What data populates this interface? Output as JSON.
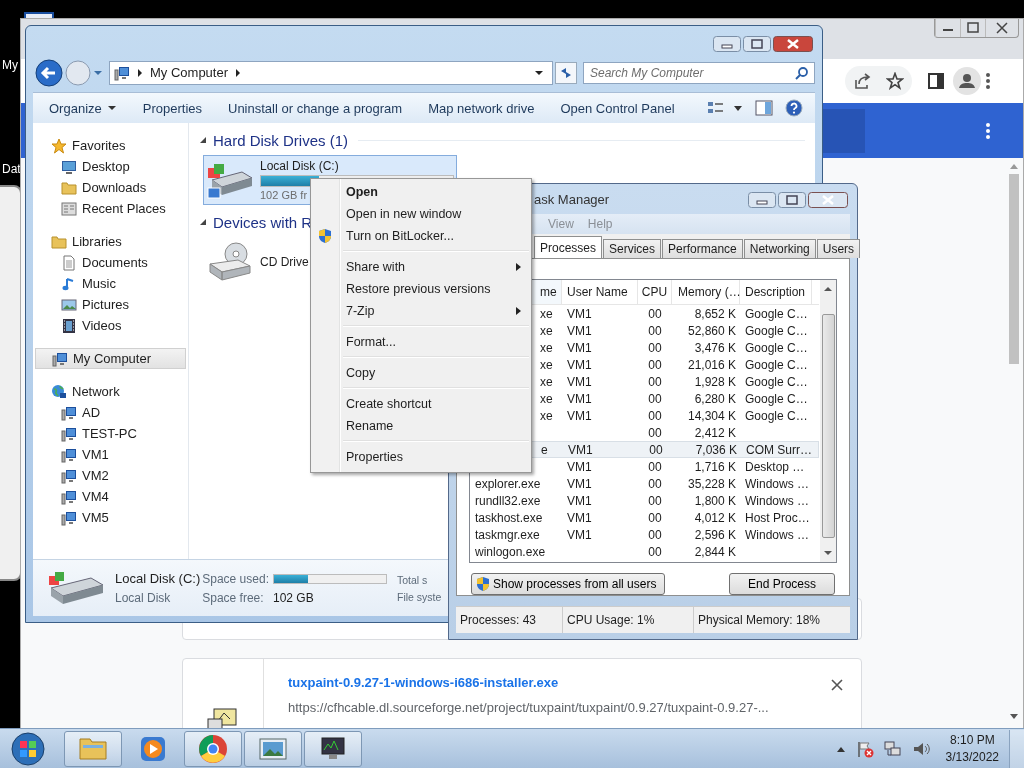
{
  "desktop": {
    "icons": [
      {
        "label": "My"
      },
      {
        "label": "Dat"
      }
    ]
  },
  "browser": {
    "downloads": [
      {
        "filename": "tuxpaint-0.9.27-1-windows-i686-installer.exe",
        "url": "https://cfhcable.dl.sourceforge.net/project/tuxpaint/tuxpaint/0.9.27/tuxpaint-0.9.27-..."
      }
    ]
  },
  "explorer": {
    "address": {
      "crumbs": [
        "My Computer"
      ]
    },
    "search": {
      "placeholder": "Search My Computer"
    },
    "toolbar": [
      {
        "label": "Organize",
        "dropdown": true
      },
      {
        "label": "Properties",
        "dropdown": false
      },
      {
        "label": "Uninstall or change a program",
        "dropdown": false
      },
      {
        "label": "Map network drive",
        "dropdown": false
      },
      {
        "label": "Open Control Panel",
        "dropdown": false
      }
    ],
    "nav": [
      {
        "label": "Favorites",
        "kind": "star",
        "selected": false,
        "children": [
          {
            "label": "Desktop",
            "kind": "monitor",
            "selected": false
          },
          {
            "label": "Downloads",
            "kind": "folder",
            "selected": false
          },
          {
            "label": "Recent Places",
            "kind": "grid",
            "selected": false
          }
        ]
      },
      {
        "label": "Libraries",
        "kind": "folder",
        "selected": false,
        "children": [
          {
            "label": "Documents",
            "kind": "document",
            "selected": false
          },
          {
            "label": "Music",
            "kind": "note",
            "selected": false
          },
          {
            "label": "Pictures",
            "kind": "picture",
            "selected": false
          },
          {
            "label": "Videos",
            "kind": "film",
            "selected": false
          }
        ]
      },
      {
        "label": "My Computer",
        "kind": "computer",
        "selected": true
      },
      {
        "label": "Network",
        "kind": "globe",
        "selected": false,
        "children": [
          {
            "label": "AD",
            "kind": "computer",
            "selected": false
          },
          {
            "label": "TEST-PC",
            "kind": "computer",
            "selected": false
          },
          {
            "label": "VM1",
            "kind": "computer",
            "selected": false
          },
          {
            "label": "VM2",
            "kind": "computer",
            "selected": false
          },
          {
            "label": "VM4",
            "kind": "computer",
            "selected": false
          },
          {
            "label": "VM5",
            "kind": "computer",
            "selected": false
          }
        ]
      }
    ],
    "groups": [
      {
        "title": "Hard Disk Drives (1)",
        "expanded": true,
        "items": [
          {
            "name": "Local Disk (C:)",
            "kind": "disk",
            "detail": "102 GB fr",
            "level": 0.3,
            "selected": true
          }
        ]
      },
      {
        "title": "Devices with R",
        "expanded": true,
        "items": [
          {
            "name": "CD Drive",
            "kind": "cd",
            "selected": false
          }
        ]
      }
    ],
    "details": {
      "name": "Local Disk (C:)",
      "type": "Local Disk",
      "used_label": "Space used:",
      "level": 0.3,
      "free_label": "Space free:",
      "free": "102 GB",
      "total_label": "Total s",
      "fs_label": "File syste"
    }
  },
  "task_manager": {
    "title": "ask Manager",
    "menu": [
      "View",
      "Help"
    ],
    "tabs": [
      {
        "label": "Processes",
        "selected": true
      },
      {
        "label": "Services",
        "selected": false
      },
      {
        "label": "Performance",
        "selected": false
      },
      {
        "label": "Networking",
        "selected": false
      },
      {
        "label": "Users",
        "selected": false
      }
    ],
    "columns": [
      {
        "label": "me",
        "cut": true
      },
      {
        "label": "User Name",
        "cut": false
      },
      {
        "label": "CPU",
        "cut": false
      },
      {
        "label": "Memory (…",
        "cut": false
      },
      {
        "label": "Description",
        "cut": false
      }
    ],
    "rows": [
      {
        "name": "xe",
        "cut": true,
        "user": "VM1",
        "cpu": "00",
        "memory": "8,652 K",
        "description": "Google C…",
        "selected": false
      },
      {
        "name": "xe",
        "cut": true,
        "user": "VM1",
        "cpu": "00",
        "memory": "52,860 K",
        "description": "Google C…",
        "selected": false
      },
      {
        "name": "xe",
        "cut": true,
        "user": "VM1",
        "cpu": "00",
        "memory": "3,476 K",
        "description": "Google C…",
        "selected": false
      },
      {
        "name": "xe",
        "cut": true,
        "user": "VM1",
        "cpu": "00",
        "memory": "21,016 K",
        "description": "Google C…",
        "selected": false
      },
      {
        "name": "xe",
        "cut": true,
        "user": "VM1",
        "cpu": "00",
        "memory": "1,928 K",
        "description": "Google C…",
        "selected": false
      },
      {
        "name": "xe",
        "cut": true,
        "user": "VM1",
        "cpu": "00",
        "memory": "6,280 K",
        "description": "Google C…",
        "selected": false
      },
      {
        "name": "xe",
        "cut": true,
        "user": "VM1",
        "cpu": "00",
        "memory": "14,304 K",
        "description": "Google C…",
        "selected": false
      },
      {
        "cpu": "00",
        "memory": "2,412 K",
        "selected": false
      },
      {
        "name": "e",
        "cut": true,
        "user": "VM1",
        "cpu": "00",
        "memory": "7,036 K",
        "description": "COM Surr…",
        "selected": true
      },
      {
        "user": "VM1",
        "cpu": "00",
        "memory": "1,716 K",
        "description": "Desktop …",
        "selected": false
      },
      {
        "name": "explorer.exe",
        "cut": false,
        "user": "VM1",
        "cpu": "00",
        "memory": "35,228 K",
        "description": "Windows …",
        "selected": false
      },
      {
        "name": "rundll32.exe",
        "cut": false,
        "user": "VM1",
        "cpu": "00",
        "memory": "1,800 K",
        "description": "Windows …",
        "selected": false
      },
      {
        "name": "taskhost.exe",
        "cut": false,
        "user": "VM1",
        "cpu": "00",
        "memory": "4,012 K",
        "description": "Host Proc…",
        "selected": false
      },
      {
        "name": "taskmgr.exe",
        "cut": false,
        "user": "VM1",
        "cpu": "00",
        "memory": "2,596 K",
        "description": "Windows …",
        "selected": false
      },
      {
        "name": "winlogon.exe",
        "cut": false,
        "cpu": "00",
        "memory": "2,844 K",
        "selected": false
      }
    ],
    "buttons": [
      {
        "label": "Show processes from all users",
        "kind": "admin"
      },
      {
        "label": "End Process",
        "kind": "plain"
      }
    ],
    "status": [
      "Processes: 43",
      "CPU Usage: 1%",
      "Physical Memory: 18%"
    ]
  },
  "context_menu": {
    "items": [
      {
        "kind": "item",
        "label": "Open",
        "default": true
      },
      {
        "kind": "item",
        "label": "Open in new window",
        "default": false
      },
      {
        "kind": "admin",
        "label": "Turn on BitLocker...",
        "default": false
      },
      {
        "kind": "separator"
      },
      {
        "kind": "item",
        "label": "Share with",
        "default": false,
        "submenu": true
      },
      {
        "kind": "item",
        "label": "Restore previous versions",
        "default": false
      },
      {
        "kind": "item",
        "label": "7-Zip",
        "default": false,
        "submenu": true
      },
      {
        "kind": "separator"
      },
      {
        "kind": "item",
        "label": "Format...",
        "default": false
      },
      {
        "kind": "separator"
      },
      {
        "kind": "item",
        "label": "Copy",
        "default": false
      },
      {
        "kind": "separator"
      },
      {
        "kind": "item",
        "label": "Create shortcut",
        "default": false
      },
      {
        "kind": "item",
        "label": "Rename",
        "default": false
      },
      {
        "kind": "separator"
      },
      {
        "kind": "item",
        "label": "Properties",
        "default": false
      }
    ]
  },
  "taskbar": {
    "apps": [
      {
        "kind": "folder",
        "running": true
      },
      {
        "kind": "media",
        "running": false
      },
      {
        "kind": "chrome",
        "running": true
      },
      {
        "kind": "photos",
        "running": true
      },
      {
        "kind": "monitor",
        "running": true
      }
    ],
    "clock": {
      "time": "8:10 PM",
      "date": "3/13/2022"
    }
  }
}
